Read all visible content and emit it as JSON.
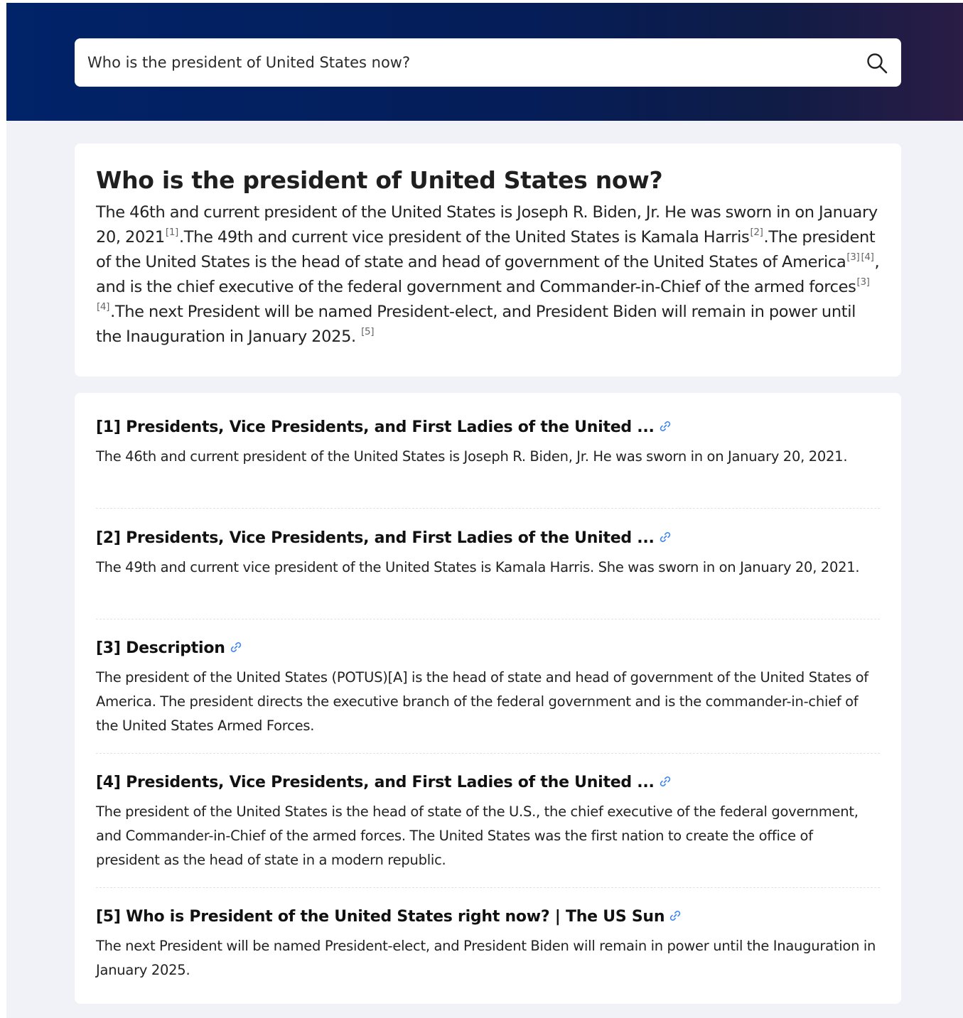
{
  "search": {
    "query": "Who is the president of United States now?"
  },
  "answer": {
    "title": "Who is the president of United States now?",
    "segments": [
      {
        "text": "The 46th and current president of the United States is Joseph R. Biden, Jr. He was sworn in on January 20, 2021"
      },
      {
        "cite": "[1]"
      },
      {
        "text": ".The 49th and current vice president of the United States is Kamala Harris"
      },
      {
        "cite": "[2]"
      },
      {
        "text": ".The president of the United States is the head of state and head of government of the United States of America"
      },
      {
        "cite": "[3]"
      },
      {
        "cite": "[4]"
      },
      {
        "text": ", and is the chief executive of the federal government and Commander-in-Chief of the armed forces"
      },
      {
        "cite": "[3]"
      },
      {
        "cite": "[4]"
      },
      {
        "text": ".The next President will be named President-elect, and President Biden will remain in power until the Inauguration in January 2025. "
      },
      {
        "cite": "[5]"
      }
    ]
  },
  "sources": [
    {
      "title": "[1] Presidents, Vice Presidents, and First Ladies of the United ...",
      "snippet": "The 46th and current president of the United States is Joseph R. Biden, Jr. He was sworn in on January 20, 2021."
    },
    {
      "title": "[2] Presidents, Vice Presidents, and First Ladies of the United ...",
      "snippet": "The 49th and current vice president of the United States is Kamala Harris. She was sworn in on January 20, 2021."
    },
    {
      "title": "[3] Description",
      "snippet": "The president of the United States (POTUS)[A] is the head of state and head of government of the United States of America. The president directs the executive branch of the federal government and is the commander-in-chief of the United States Armed Forces."
    },
    {
      "title": "[4] Presidents, Vice Presidents, and First Ladies of the United ...",
      "snippet": "The president of the United States is the head of state of the U.S., the chief executive of the federal government, and Commander-in-Chief of the armed forces. The United States was the first nation to create the office of president as the head of state in a modern republic."
    },
    {
      "title": "[5] Who is President of the United States right now? | The US Sun",
      "snippet": "The next President will be named President-elect, and President Biden will remain in power until the Inauguration in January 2025."
    }
  ],
  "icons": {
    "search": "search-icon",
    "link": "link-icon"
  },
  "colors": {
    "header_start": "#012369",
    "header_end": "#2a1c45",
    "page_background": "#f0f2f7",
    "link_icon": "#3b82f6"
  }
}
